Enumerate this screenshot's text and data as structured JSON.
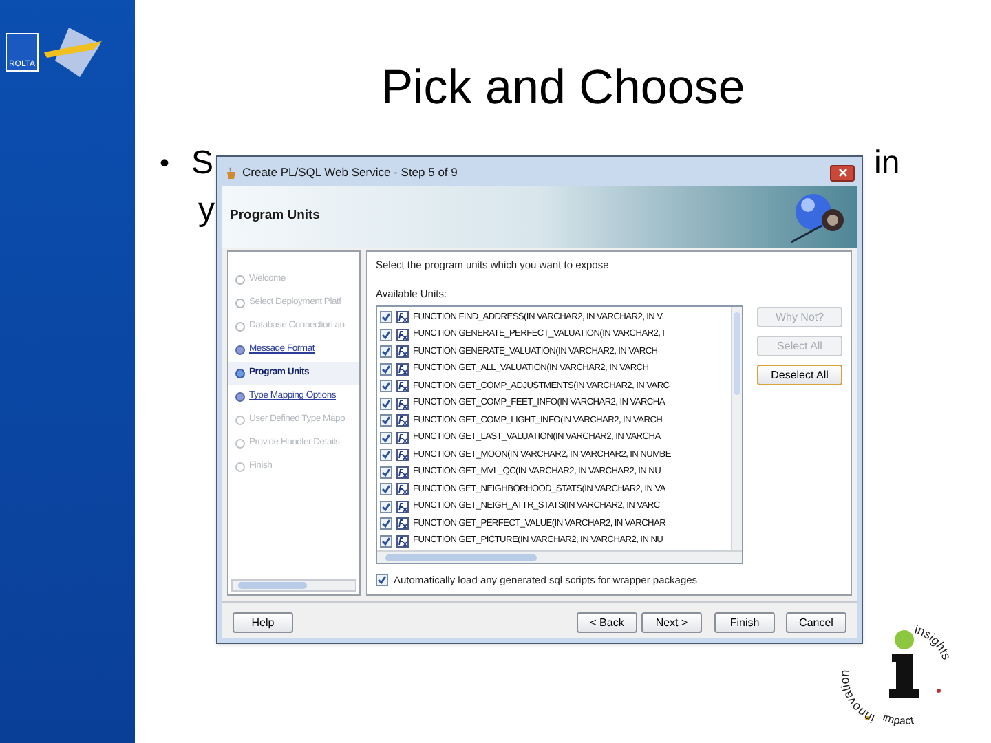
{
  "slide": {
    "title": "Pick and Choose",
    "bullet": "•",
    "fragments": [
      "S",
      "in",
      "y"
    ]
  },
  "logos": {
    "top_left": "ROLTA",
    "bottom_right": [
      "innovation",
      "insights",
      "impact"
    ]
  },
  "window": {
    "title": "Create PL/SQL Web Service - Step 5 of 9",
    "header": "Program Units",
    "steps": [
      {
        "label": "Welcome",
        "kind": "done",
        "selected": false
      },
      {
        "label": "Select Deployment Platf",
        "kind": "done",
        "selected": false
      },
      {
        "label": "Database Connection an",
        "kind": "done",
        "selected": false
      },
      {
        "label": "Message Format",
        "kind": "visited",
        "selected": false
      },
      {
        "label": "Program Units",
        "kind": "current",
        "selected": true
      },
      {
        "label": "Type Mapping Options",
        "kind": "visited",
        "selected": false
      },
      {
        "label": "User Defined Type Mapp",
        "kind": "pending",
        "selected": false
      },
      {
        "label": "Provide Handler Details",
        "kind": "pending",
        "selected": false
      },
      {
        "label": "Finish",
        "kind": "pending",
        "selected": false
      }
    ],
    "instruction": "Select the program units which you want to expose",
    "list_label": "Available Units:",
    "units": [
      {
        "label": "FUNCTION FIND_ADDRESS(IN VARCHAR2, IN VARCHAR2, IN V",
        "checked": true
      },
      {
        "label": "FUNCTION GENERATE_PERFECT_VALUATION(IN VARCHAR2, I",
        "checked": true
      },
      {
        "label": "FUNCTION GENERATE_VALUATION(IN VARCHAR2, IN VARCH",
        "checked": true
      },
      {
        "label": "FUNCTION GET_ALL_VALUATION(IN VARCHAR2, IN VARCH",
        "checked": true
      },
      {
        "label": "FUNCTION GET_COMP_ADJUSTMENTS(IN VARCHAR2, IN VARC",
        "checked": true
      },
      {
        "label": "FUNCTION GET_COMP_FEET_INFO(IN VARCHAR2, IN VARCHA",
        "checked": true
      },
      {
        "label": "FUNCTION GET_COMP_LIGHT_INFO(IN VARCHAR2, IN VARCH",
        "checked": true
      },
      {
        "label": "FUNCTION GET_LAST_VALUATION(IN VARCHAR2, IN VARCHA",
        "checked": true
      },
      {
        "label": "FUNCTION GET_MOON(IN VARCHAR2, IN VARCHAR2, IN NUMBE",
        "checked": true
      },
      {
        "label": "FUNCTION GET_MVL_QC(IN VARCHAR2, IN VARCHAR2, IN NU",
        "checked": true
      },
      {
        "label": "FUNCTION GET_NEIGHBORHOOD_STATS(IN VARCHAR2, IN VA",
        "checked": true
      },
      {
        "label": "FUNCTION GET_NEIGH_ATTR_STATS(IN VARCHAR2, IN VARC",
        "checked": true
      },
      {
        "label": "FUNCTION GET_PERFECT_VALUE(IN VARCHAR2, IN VARCHAR",
        "checked": true
      },
      {
        "label": "FUNCTION GET_PICTURE(IN VARCHAR2, IN VARCHAR2, IN NU",
        "checked": true
      }
    ],
    "side_buttons": [
      {
        "label": "Why Not?",
        "disabled": true
      },
      {
        "label": "Select All",
        "disabled": true
      },
      {
        "label": "Deselect All",
        "disabled": false
      }
    ],
    "auto_load": {
      "label": "Automatically load any generated sql scripts for wrapper packages",
      "checked": true
    },
    "footer_buttons": [
      {
        "label": "Help"
      },
      {
        "label": "< Back"
      },
      {
        "label": "Next >"
      },
      {
        "label": "Finish"
      },
      {
        "label": "Cancel"
      }
    ]
  }
}
